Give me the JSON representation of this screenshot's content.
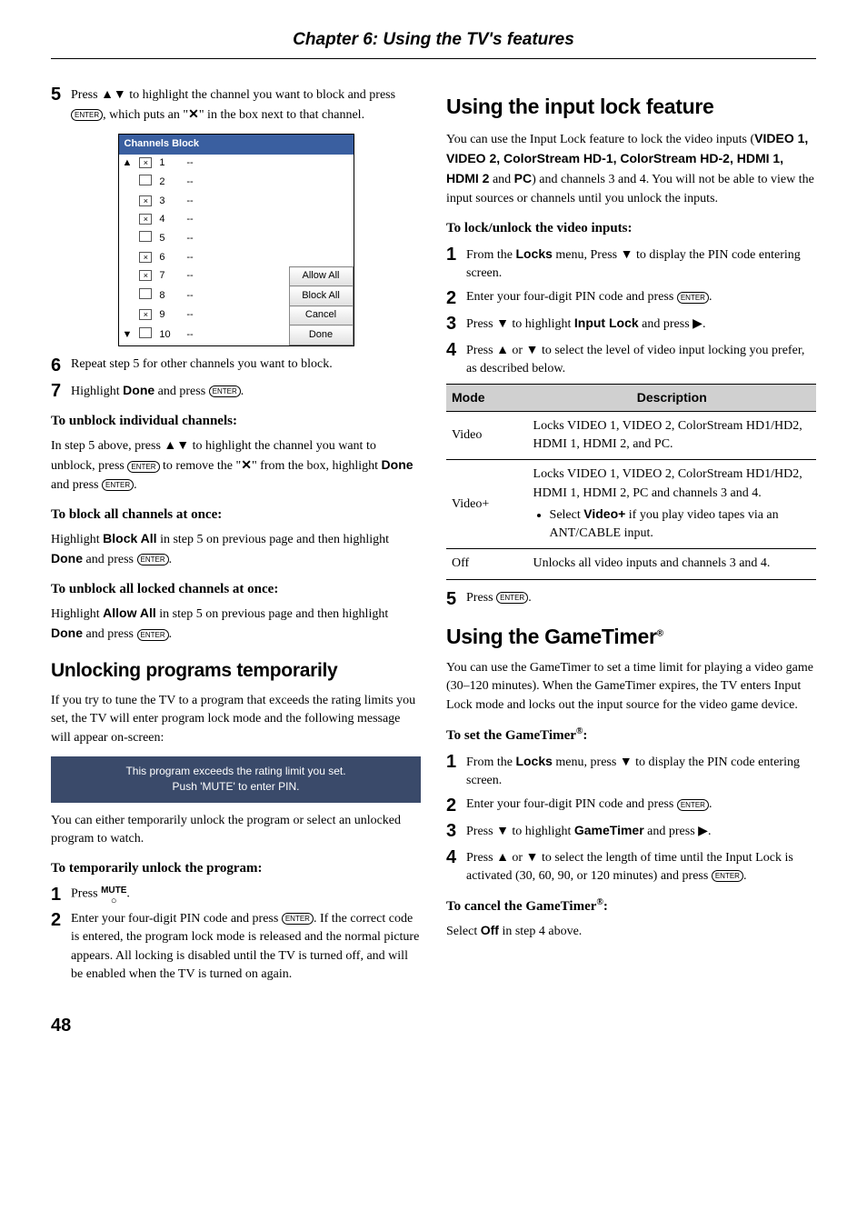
{
  "chapter_title": "Chapter 6: Using the TV's features",
  "left": {
    "step5": {
      "num": "5",
      "text_a": "Press ",
      "text_b": " to highlight the channel you want to block and press ",
      "text_c": ", which puts an \"",
      "text_d": "\" in the box next to that channel."
    },
    "channels_block": {
      "title": "Channels Block",
      "rows": [
        {
          "chk": true,
          "n": "1",
          "v": "--"
        },
        {
          "chk": false,
          "n": "2",
          "v": "--"
        },
        {
          "chk": true,
          "n": "3",
          "v": "--"
        },
        {
          "chk": true,
          "n": "4",
          "v": "--"
        },
        {
          "chk": false,
          "n": "5",
          "v": "--"
        },
        {
          "chk": true,
          "n": "6",
          "v": "--"
        },
        {
          "chk": true,
          "n": "7",
          "v": "--",
          "btn": "Allow All"
        },
        {
          "chk": false,
          "n": "8",
          "v": "--",
          "btn": "Block All"
        },
        {
          "chk": true,
          "n": "9",
          "v": "--",
          "btn": "Cancel"
        },
        {
          "chk": false,
          "n": "10",
          "v": "--",
          "btn": "Done"
        }
      ]
    },
    "step6": {
      "num": "6",
      "text": "Repeat step 5 for other channels you want to block."
    },
    "step7": {
      "num": "7",
      "text_a": "Highlight ",
      "done": "Done",
      "text_b": " and press ",
      "text_c": "."
    },
    "sub_unblock_ind": "To unblock individual channels:",
    "unblock_ind_text_a": "In step 5 above, press ",
    "unblock_ind_text_b": " to highlight the channel you want to unblock, press ",
    "unblock_ind_text_c": " to remove the \"",
    "unblock_ind_text_d": "\" from the box, highlight ",
    "unblock_ind_text_e": " and press ",
    "unblock_ind_text_f": ".",
    "sub_block_all": "To block all channels at once:",
    "block_all_text_a": "Highlight ",
    "block_all_label": "Block All",
    "block_all_text_b": " in step 5 on previous page and then highlight ",
    "block_all_text_c": " and press ",
    "block_all_text_d": ".",
    "sub_unblock_all": "To unblock all locked channels at once:",
    "unblock_all_text_a": "Highlight ",
    "unblock_all_label": "Allow All",
    "unblock_all_text_b": " in step 5 on previous page and then highlight ",
    "unblock_all_text_c": " and press ",
    "unblock_all_text_d": ".",
    "heading_unlock": "Unlocking programs temporarily",
    "unlock_intro": "If you try to tune the TV to a program that exceeds the rating limits you set, the TV will enter program lock mode and the following message will appear on-screen:",
    "rating_msg_l1": "This program exceeds the rating limit you set.",
    "rating_msg_l2": "Push 'MUTE' to enter PIN.",
    "unlock_after": "You can either temporarily unlock the program or select an unlocked program to watch.",
    "sub_temp_unlock": "To temporarily unlock the program:",
    "temp1": {
      "num": "1",
      "text_a": "Press ",
      "text_b": "."
    },
    "temp2": {
      "num": "2",
      "text_a": "Enter your four-digit PIN code and press ",
      "text_b": ". If the correct code is entered, the program lock mode is released and the normal picture appears. All locking is disabled until the TV is turned off, and will be enabled when the TV is turned on again."
    },
    "done_label": "Done",
    "mute_label": "MUTE"
  },
  "right": {
    "heading_input_lock": "Using the input lock feature",
    "il_intro_a": "You can use the Input Lock feature to lock the video inputs (",
    "il_inputs": "VIDEO 1, VIDEO 2, ColorStream HD-1, ColorStream HD-2, HDMI 1, HDMI 2",
    "il_and": " and ",
    "il_pc": "PC",
    "il_intro_b": ") and channels 3 and 4. You will not be able to view the input sources or channels until you unlock the inputs.",
    "sub_lock_unlock": "To lock/unlock the video inputs:",
    "il1": {
      "num": "1",
      "text_a": "From the ",
      "locks": "Locks",
      "text_b": " menu, Press ",
      "text_c": " to display the PIN code entering screen."
    },
    "il2": {
      "num": "2",
      "text_a": "Enter your four-digit PIN code and press ",
      "text_b": "."
    },
    "il3": {
      "num": "3",
      "text_a": "Press ",
      "text_b": " to highlight ",
      "input_lock": "Input Lock",
      "text_c": " and press ",
      "text_d": "."
    },
    "il4": {
      "num": "4",
      "text_a": "Press ",
      "text_b": " or ",
      "text_c": " to select the level of video input locking you prefer, as described below."
    },
    "table": {
      "h_mode": "Mode",
      "h_desc": "Description",
      "r1_mode": "Video",
      "r1_desc": "Locks VIDEO 1, VIDEO 2, ColorStream HD1/HD2, HDMI 1, HDMI 2, and PC.",
      "r2_mode": "Video+",
      "r2_desc_a": "Locks VIDEO 1, VIDEO 2, ColorStream HD1/HD2, HDMI 1, HDMI 2, PC and channels 3 and 4.",
      "r2_bullet_a": "Select ",
      "r2_bullet_b": "Video+",
      "r2_bullet_c": " if you play video tapes via an ANT/CABLE input.",
      "r3_mode": "Off",
      "r3_desc": "Unlocks all video inputs and channels 3 and 4."
    },
    "il5": {
      "num": "5",
      "text_a": "Press ",
      "text_b": "."
    },
    "heading_gametimer_a": "Using the GameTimer",
    "heading_gametimer_sup": "®",
    "gt_intro": "You can use the GameTimer to set a time limit for playing a video game (30–120 minutes). When the GameTimer expires, the TV enters Input Lock mode and locks out the input source for the video game device.",
    "sub_set_gt_a": "To set the GameTimer",
    "sub_set_gt_sup": "®",
    "sub_set_gt_b": ":",
    "gt1": {
      "num": "1",
      "text_a": "From the ",
      "locks": "Locks",
      "text_b": " menu, press ",
      "text_c": " to display the PIN code entering screen."
    },
    "gt2": {
      "num": "2",
      "text_a": "Enter your four-digit PIN code and press ",
      "text_b": "."
    },
    "gt3": {
      "num": "3",
      "text_a": "Press ",
      "text_b": " to highlight ",
      "gametimer": "GameTimer",
      "text_c": " and press ",
      "text_d": "."
    },
    "gt4": {
      "num": "4",
      "text_a": "Press ",
      "text_b": " or ",
      "text_c": " to select the length of time until the Input Lock is activated (30, 60, 90, or 120 minutes) and press ",
      "text_d": "."
    },
    "sub_cancel_gt_a": "To cancel the GameTimer",
    "sub_cancel_gt_sup": "®",
    "sub_cancel_gt_b": ":",
    "cancel_gt_a": "Select ",
    "cancel_gt_off": "Off",
    "cancel_gt_b": " in step 4 above."
  },
  "page_number": "48",
  "icons": {
    "enter": "ENTER",
    "up": "▲",
    "down": "▼",
    "right": "▶",
    "x": "✕"
  }
}
